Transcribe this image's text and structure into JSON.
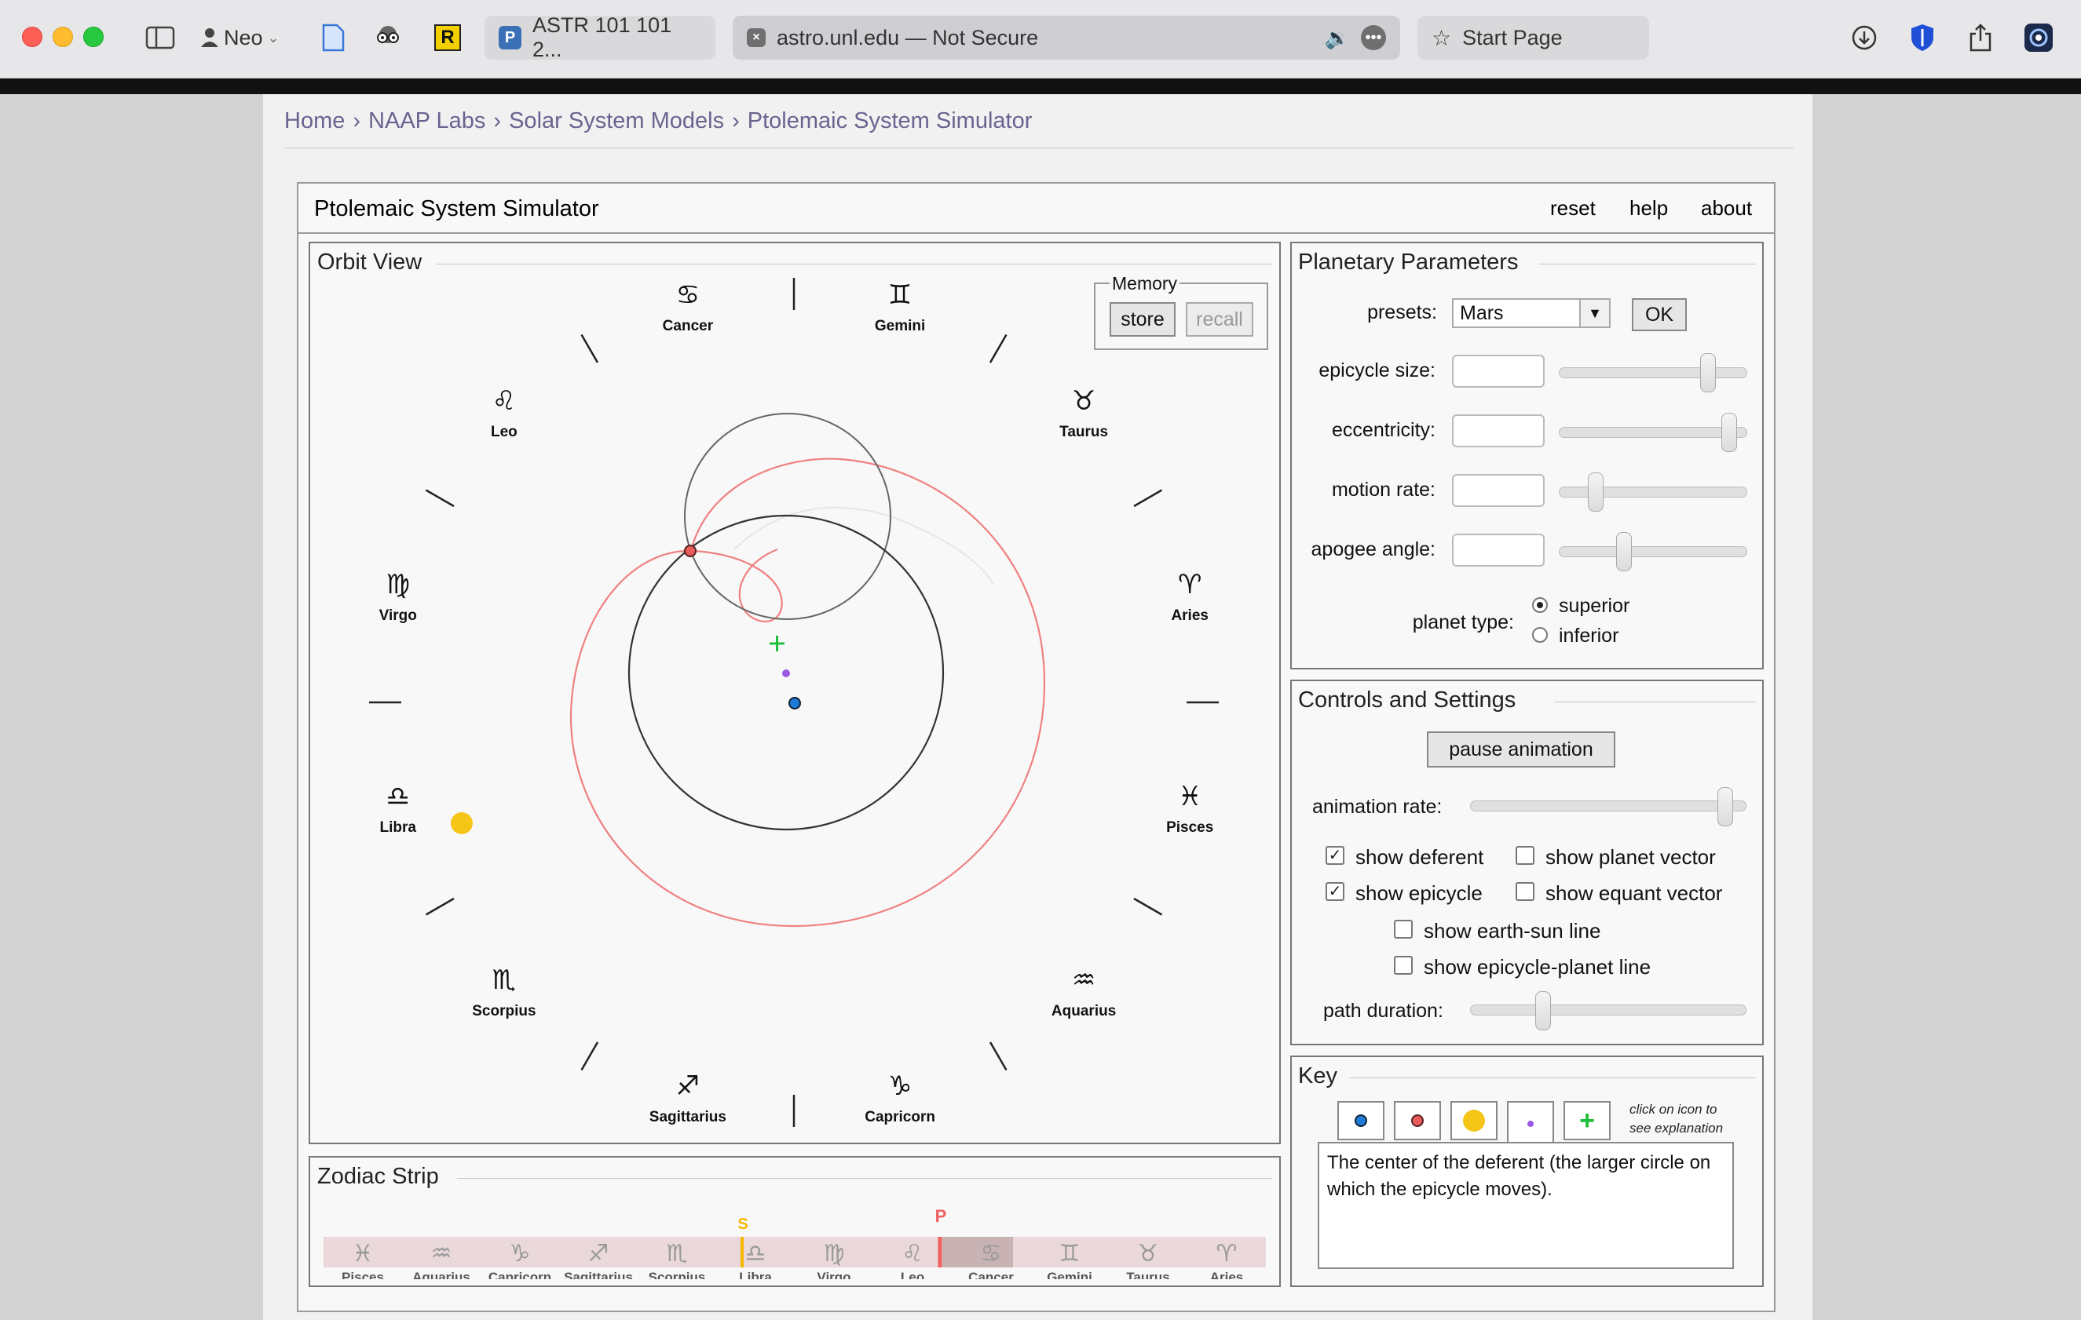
{
  "browser": {
    "profile_name": "Neo",
    "tabs": [
      {
        "label": "ASTR 101 101 2...",
        "favicon": "P"
      },
      {
        "label": "astro.unl.edu — Not Secure"
      },
      {
        "label": "Start Page"
      }
    ]
  },
  "breadcrumb": [
    "Home",
    "NAAP Labs",
    "Solar System Models",
    "Ptolemaic System Simulator"
  ],
  "app": {
    "title": "Ptolemaic System Simulator",
    "menu": [
      "reset",
      "help",
      "about"
    ]
  },
  "orbit_view": {
    "title": "Orbit View",
    "memory": {
      "label": "Memory",
      "store": "store",
      "recall": "recall"
    },
    "zodiac": [
      {
        "name": "Cancer",
        "glyph": "♋"
      },
      {
        "name": "Gemini",
        "glyph": "♊"
      },
      {
        "name": "Taurus",
        "glyph": "♉"
      },
      {
        "name": "Aries",
        "glyph": "♈"
      },
      {
        "name": "Pisces",
        "glyph": "♓"
      },
      {
        "name": "Aquarius",
        "glyph": "♒"
      },
      {
        "name": "Capricorn",
        "glyph": "♑"
      },
      {
        "name": "Sagittarius",
        "glyph": "♐"
      },
      {
        "name": "Scorpius",
        "glyph": "♏"
      },
      {
        "name": "Libra",
        "glyph": "♎"
      },
      {
        "name": "Virgo",
        "glyph": "♍"
      },
      {
        "name": "Leo",
        "glyph": "♌"
      }
    ]
  },
  "parameters": {
    "title": "Planetary Parameters",
    "presets_label": "presets:",
    "preset_value": "Mars",
    "ok": "OK",
    "rows": [
      {
        "label": "epicycle size:",
        "level": 0.82
      },
      {
        "label": "eccentricity:",
        "level": 0.94
      },
      {
        "label": "motion rate:",
        "level": 0.17
      },
      {
        "label": "apogee angle:",
        "level": 0.33
      }
    ],
    "planet_type_label": "planet type:",
    "planet_types": [
      "superior",
      "inferior"
    ],
    "planet_type_selected": "superior"
  },
  "controls": {
    "title": "Controls and Settings",
    "pause": "pause animation",
    "animation_rate_label": "animation rate:",
    "animation_rate_level": 0.95,
    "checks": [
      {
        "label": "show deferent",
        "checked": true
      },
      {
        "label": "show planet vector",
        "checked": false
      },
      {
        "label": "show epicycle",
        "checked": true
      },
      {
        "label": "show equant vector",
        "checked": false
      },
      {
        "label": "show earth-sun line",
        "checked": false
      },
      {
        "label": "show epicycle-planet line",
        "checked": false
      }
    ],
    "path_duration_label": "path duration:",
    "path_duration_level": 0.25
  },
  "key": {
    "title": "Key",
    "hint_line1": "click on icon to",
    "hint_line2": "see explanation",
    "icons": [
      "earth-icon",
      "planet-icon",
      "sun-icon",
      "equant-icon",
      "deferent-center-icon"
    ],
    "explanation": "The center of the deferent (the larger circle on which the epicycle moves)."
  },
  "zodiac_strip": {
    "title": "Zodiac Strip",
    "sun_marker": "S",
    "planet_marker": "P",
    "signs": [
      "Pisces",
      "Aquarius",
      "Capricorn",
      "Sagittarius",
      "Scorpius",
      "Libra",
      "Virgo",
      "Leo",
      "Cancer",
      "Gemini",
      "Taurus",
      "Aries"
    ]
  },
  "colors": {
    "planet_path": "#f08080",
    "sun": "#f5c518",
    "earth": "#1e7bd8",
    "equant": "#9b59e6",
    "deferent_center": "#1fbf3a",
    "link": "#6b6390"
  }
}
